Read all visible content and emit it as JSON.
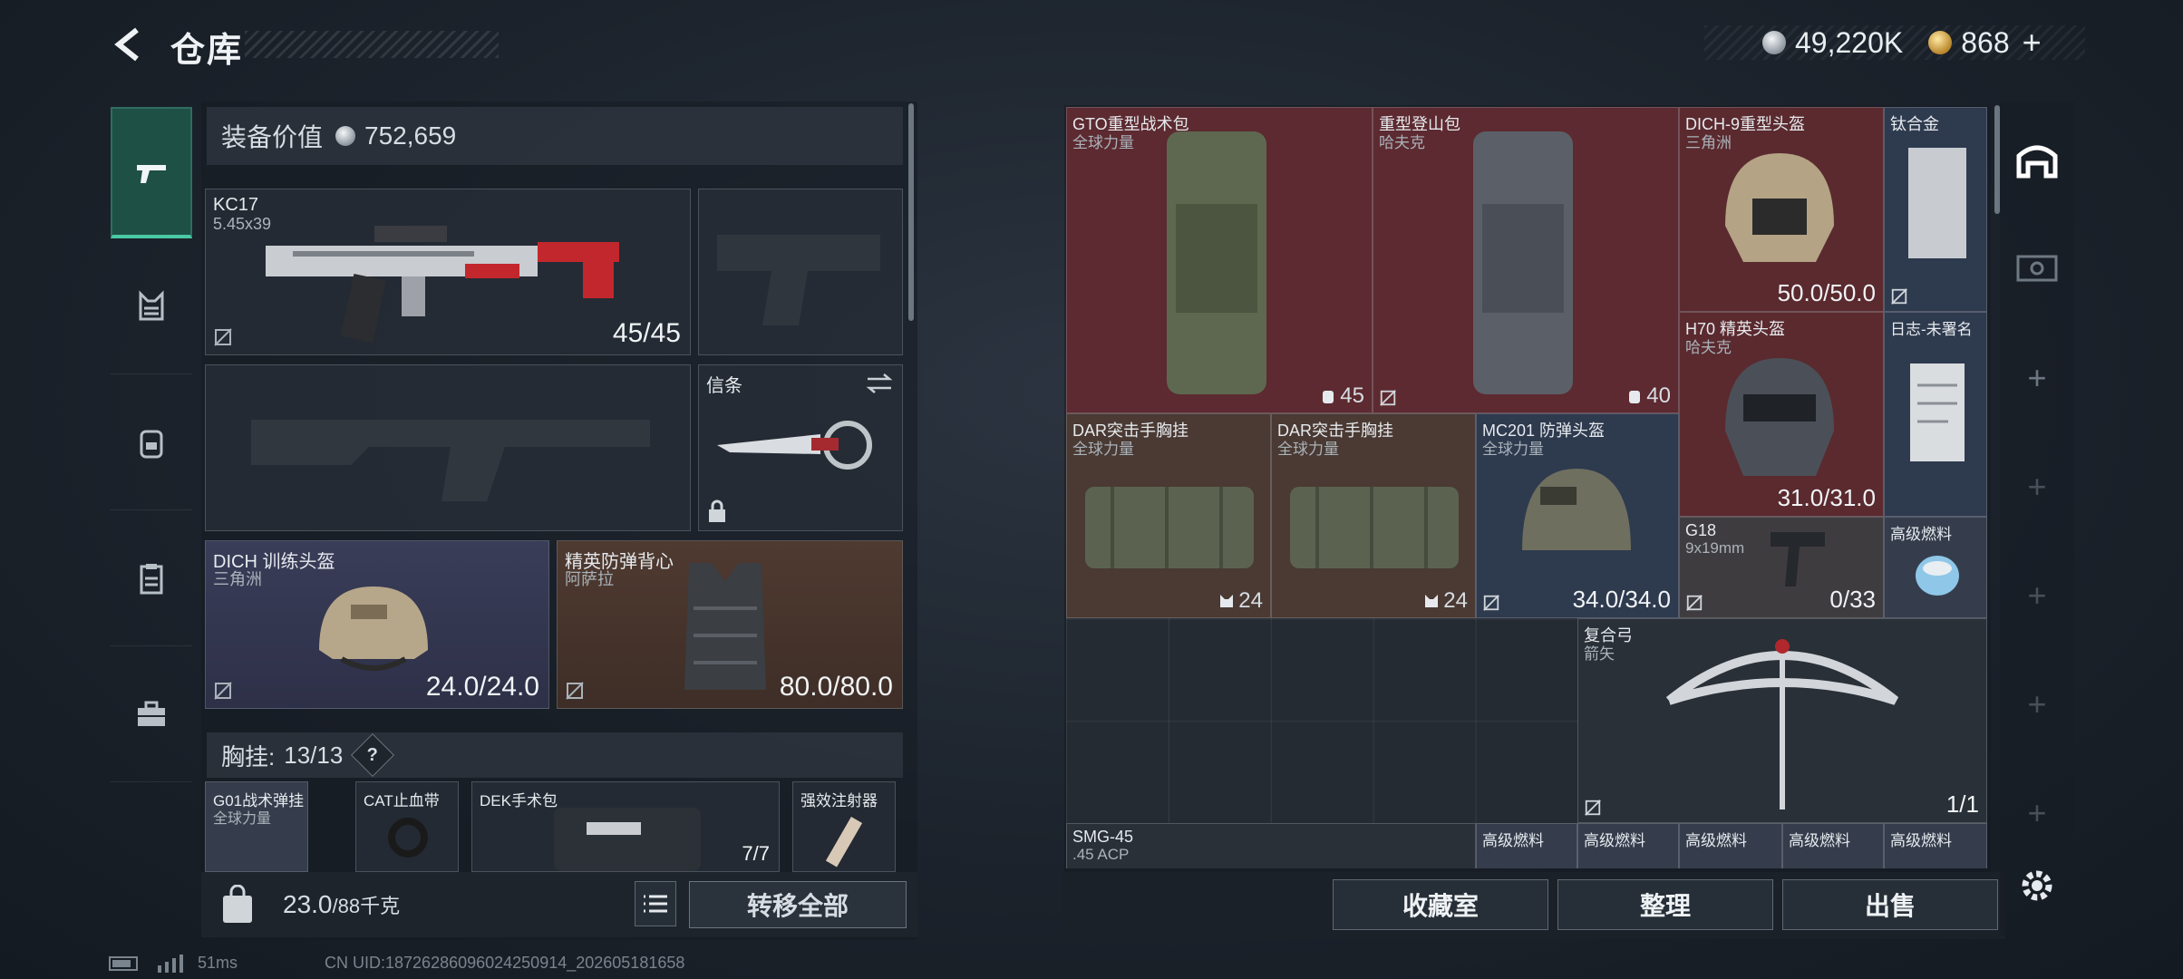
{
  "header": {
    "title": "仓库",
    "currency_silver": "49,220K",
    "currency_gold": "868",
    "add_symbol": "+"
  },
  "categories": [
    {
      "icon": "pistol-icon",
      "active": true
    },
    {
      "icon": "chest-rig-icon",
      "active": false
    },
    {
      "icon": "backpack-icon",
      "active": false
    },
    {
      "icon": "clipboard-icon",
      "active": false
    },
    {
      "icon": "toolbox-icon",
      "active": false
    }
  ],
  "gear": {
    "value_label": "装备价值",
    "value": "752,659",
    "primary_weapon": {
      "name": "KC17",
      "sub": "5.45x39",
      "count": "45/45"
    },
    "melee": {
      "name": "信条"
    },
    "helmet": {
      "name": "DICH 训练头盔",
      "sub": "三角洲",
      "count": "24.0/24.0"
    },
    "armor": {
      "name": "精英防弹背心",
      "sub": "阿萨拉",
      "count": "80.0/80.0"
    },
    "chest_rig_label": "胸挂:",
    "chest_rig_count": "13/13",
    "help_mark": "?",
    "rig_items": [
      {
        "name": "G01战术弹挂",
        "sub": "全球力量"
      },
      {
        "name": "CAT止血带"
      },
      {
        "name": "DEK手术包",
        "count": "7/7"
      },
      {
        "name": "强效注射器"
      }
    ],
    "weight": "23.0",
    "weight_max": "/88千克",
    "weight_icon_label": "KG",
    "transfer_all": "转移全部"
  },
  "stash": {
    "items": [
      {
        "name": "GTO重型战术包",
        "sub": "全球力量",
        "cap": "45"
      },
      {
        "name": "重型登山包",
        "sub": "哈夫克",
        "cap": "40"
      },
      {
        "name": "DICH-9重型头盔",
        "sub": "三角洲",
        "count": "50.0/50.0"
      },
      {
        "name": "钛合金"
      },
      {
        "name": "H70 精英头盔",
        "sub": "哈夫克",
        "count": "31.0/31.0"
      },
      {
        "name": "日志-未署名"
      },
      {
        "name": "DAR突击手胸挂",
        "sub": "全球力量",
        "cap": "24"
      },
      {
        "name": "DAR突击手胸挂",
        "sub": "全球力量",
        "cap": "24"
      },
      {
        "name": "MC201 防弹头盔",
        "sub": "全球力量",
        "count": "34.0/34.0"
      },
      {
        "name": "G18",
        "sub": "9x19mm",
        "count": "0/33"
      },
      {
        "name": "高级燃料"
      },
      {
        "name": "复合弓",
        "sub": "箭矢",
        "count": "1/1"
      },
      {
        "name": "SMG-45",
        "sub": ".45 ACP"
      },
      {
        "name": "高级燃料"
      },
      {
        "name": "高级燃料"
      },
      {
        "name": "高级燃料"
      },
      {
        "name": "高级燃料"
      },
      {
        "name": "高级燃料"
      }
    ],
    "buttons": {
      "collection": "收藏室",
      "sort": "整理",
      "sell": "出售"
    }
  },
  "status": {
    "ping": "51ms",
    "uid": "CN UID:18726286096024250914_202605181658"
  },
  "colors": {
    "accent": "#49c9a4",
    "red_slot": "#5c2a30",
    "purple_slot": "#3a3d58",
    "brown_slot": "#4f3a30"
  }
}
